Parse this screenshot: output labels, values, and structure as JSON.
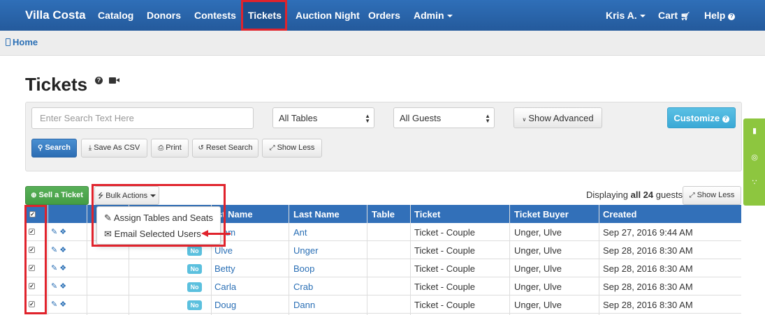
{
  "nav": {
    "brand": "Villa Costa",
    "items": [
      "Catalog",
      "Donors",
      "Contests",
      "Tickets",
      "Auction Night",
      "Orders",
      "Admin"
    ],
    "user": "Kris A.",
    "cart": "Cart",
    "help": "Help"
  },
  "breadcrumb": {
    "home": "Home"
  },
  "page": {
    "title": "Tickets"
  },
  "search": {
    "placeholder": "Enter Search Text Here",
    "tables_select": "All Tables",
    "guests_select": "All Guests",
    "show_advanced": "Show Advanced",
    "customize": "Customize",
    "search_btn": "Search",
    "csv_btn": "Save As CSV",
    "print_btn": "Print",
    "reset_btn": "Reset Search",
    "less_btn": "Show Less"
  },
  "actions": {
    "sell": "Sell a Ticket",
    "bulk": "Bulk Actions",
    "display_prefix": "Displaying",
    "display_count": "all 24",
    "display_suffix": "guests",
    "show_less": "Show Less"
  },
  "dropdown": {
    "items": [
      "Assign Tables and Seats",
      "Email Selected Users"
    ]
  },
  "table": {
    "headers": [
      "st Name",
      "Last Name",
      "Table",
      "Ticket",
      "Ticket Buyer",
      "Created"
    ],
    "rows": [
      {
        "first": "am",
        "last": "Ant",
        "badge": "",
        "ticket": "Ticket - Couple",
        "buyer": "Unger, Ulve",
        "created": "Sep 27, 2016 9:44 AM"
      },
      {
        "first": "Ulve",
        "last": "Unger",
        "badge": "No",
        "ticket": "Ticket - Couple",
        "buyer": "Unger, Ulve",
        "created": "Sep 28, 2016 8:30 AM"
      },
      {
        "first": "Betty",
        "last": "Boop",
        "badge": "No",
        "ticket": "Ticket - Couple",
        "buyer": "Unger, Ulve",
        "created": "Sep 28, 2016 8:30 AM"
      },
      {
        "first": "Carla",
        "last": "Crab",
        "badge": "No",
        "ticket": "Ticket - Couple",
        "buyer": "Unger, Ulve",
        "created": "Sep 28, 2016 8:30 AM"
      },
      {
        "first": "Doug",
        "last": "Dann",
        "badge": "No",
        "ticket": "Ticket - Couple",
        "buyer": "Unger, Ulve",
        "created": "Sep 28, 2016 8:30 AM"
      }
    ]
  },
  "icons": {
    "help": "question-circle-icon",
    "video": "video-camera-icon",
    "cart": "cart-icon",
    "edit": "edit-icon",
    "ticket": "ticket-icon"
  },
  "colors": {
    "nav_bg": "#2a63a8",
    "highlight": "#e0232c",
    "primary": "#3270b9",
    "success": "#449d44",
    "info": "#5bc0de",
    "side_widget": "#8dc63f"
  }
}
